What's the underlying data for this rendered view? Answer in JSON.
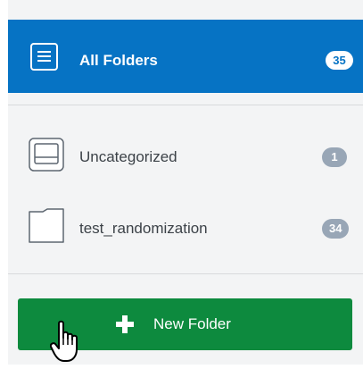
{
  "all_folders": {
    "label": "All Folders",
    "count": "35",
    "icon": "list-icon"
  },
  "folders": [
    {
      "label": "Uncategorized",
      "count": "1",
      "icon": "inbox-tray-icon"
    },
    {
      "label": "test_randomization",
      "count": "34",
      "icon": "folder-icon"
    }
  ],
  "new_folder_button": {
    "label": "New Folder",
    "icon": "plus-icon"
  },
  "colors": {
    "selected_bg": "#0673c4",
    "button_bg": "#0d8a3e",
    "badge_bg": "#98a6b6",
    "panel_bg": "#f3f4f5"
  }
}
